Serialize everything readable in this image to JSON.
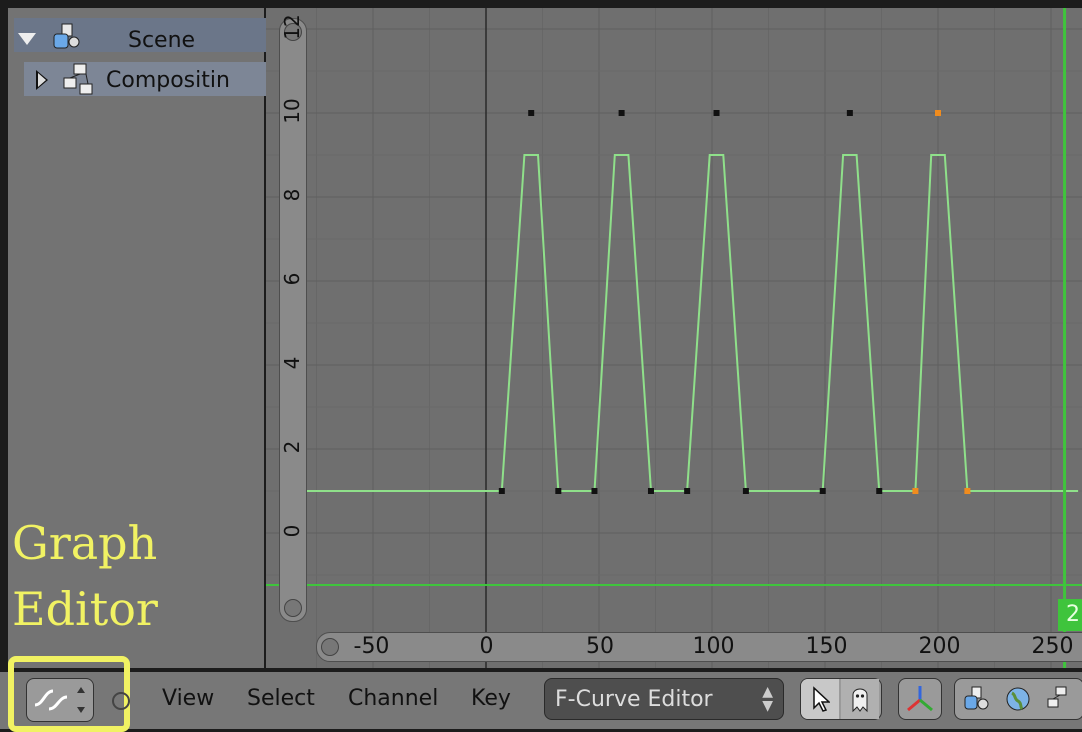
{
  "outliner": {
    "items": [
      {
        "label": "Scene",
        "icon": "scene-icon",
        "expanded": true
      },
      {
        "label": "Compositin",
        "icon": "node-tree-icon",
        "expanded": false
      }
    ]
  },
  "annotation": {
    "line1": "Graph",
    "line2": "Editor",
    "highlight_color": "#f1f263"
  },
  "graph": {
    "y_ticks": [
      "0",
      "2",
      "4",
      "6",
      "8",
      "10",
      "12"
    ],
    "x_ticks": [
      "-50",
      "0",
      "50",
      "100",
      "150",
      "200",
      "250"
    ],
    "current_frame_label": "2",
    "curve_color": "#8fe08a",
    "playhead_color": "#3fc43c"
  },
  "chart_data": {
    "type": "line",
    "xlim": [
      -80,
      262
    ],
    "ylim": [
      -1.5,
      12.5
    ],
    "series": [
      {
        "color": "#8fe08a",
        "x": [
          -80,
          7,
          17,
          23,
          32,
          48,
          57,
          63,
          73,
          89,
          99,
          105,
          115,
          149,
          158,
          164,
          174,
          190,
          197,
          203,
          213,
          262
        ],
        "y": [
          1,
          1,
          9,
          9,
          1,
          1,
          9,
          9,
          1,
          1,
          9,
          9,
          1,
          1,
          9,
          9,
          1,
          1,
          9,
          9,
          1,
          1
        ]
      }
    ],
    "keyframes": [
      {
        "x": 7,
        "y": 1,
        "selected": false
      },
      {
        "x": 20,
        "y": 10,
        "selected": false
      },
      {
        "x": 32,
        "y": 1,
        "selected": false
      },
      {
        "x": 48,
        "y": 1,
        "selected": false
      },
      {
        "x": 60,
        "y": 10,
        "selected": false
      },
      {
        "x": 73,
        "y": 1,
        "selected": false
      },
      {
        "x": 89,
        "y": 1,
        "selected": false
      },
      {
        "x": 102,
        "y": 10,
        "selected": false
      },
      {
        "x": 115,
        "y": 1,
        "selected": false
      },
      {
        "x": 149,
        "y": 1,
        "selected": false
      },
      {
        "x": 161,
        "y": 10,
        "selected": false
      },
      {
        "x": 174,
        "y": 1,
        "selected": false
      },
      {
        "x": 190,
        "y": 1,
        "selected": true
      },
      {
        "x": 200,
        "y": 10,
        "selected": true
      },
      {
        "x": 213,
        "y": 1,
        "selected": true
      }
    ],
    "current_frame": 256,
    "grid": true
  },
  "header": {
    "editor_type_icon": "graph-editor-icon",
    "menus": [
      "View",
      "Select",
      "Channel",
      "Key"
    ],
    "mode": {
      "value": "F-Curve Editor"
    },
    "tools": [
      "cursor-select-icon",
      "ghost-curve-icon",
      "transform-axes-icon",
      "scene-icon",
      "world-icon",
      "node-tree-icon"
    ]
  }
}
